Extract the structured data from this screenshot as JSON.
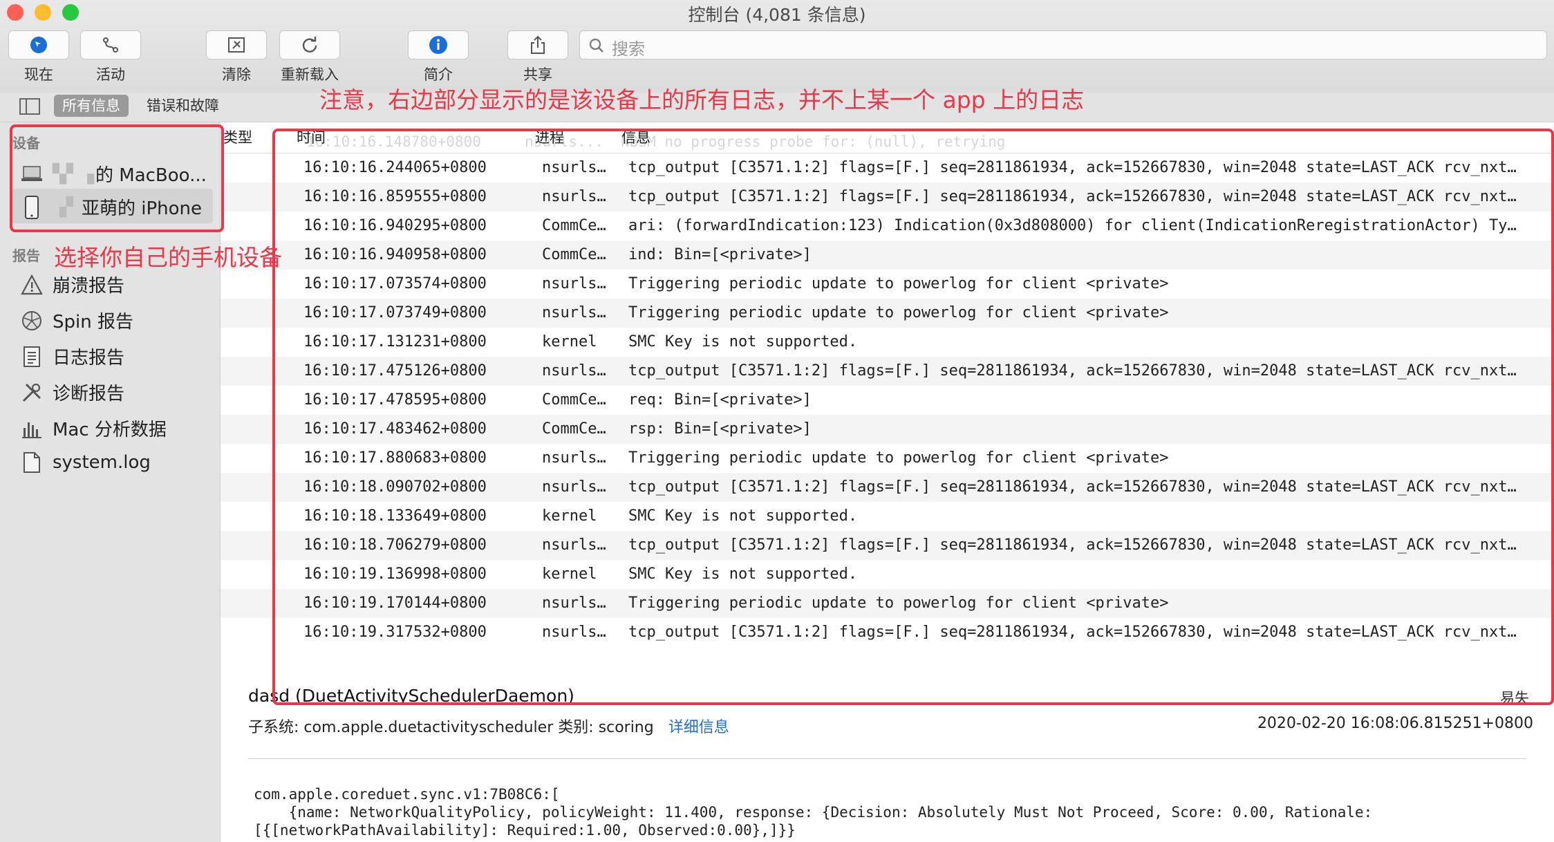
{
  "window": {
    "title": "控制台 (4,081 条信息)"
  },
  "toolbar": {
    "now": "现在",
    "activity": "活动",
    "clear": "清除",
    "reload": "重新载入",
    "info": "简介",
    "share": "共享",
    "search_placeholder": "搜索"
  },
  "filter": {
    "all": "所有信息",
    "errors": "错误和故障"
  },
  "sidebar": {
    "devices_header": "设备",
    "devices": [
      {
        "label": "的 MacBoo...",
        "icon": "laptop-icon"
      },
      {
        "label": "亚萌的 iPhone",
        "icon": "phone-icon"
      }
    ],
    "reports_header": "报告",
    "reports": [
      {
        "label": "崩溃报告",
        "icon": "warning-icon"
      },
      {
        "label": "Spin 报告",
        "icon": "spin-icon"
      },
      {
        "label": "日志报告",
        "icon": "document-icon"
      },
      {
        "label": "诊断报告",
        "icon": "tools-icon"
      },
      {
        "label": "Mac 分析数据",
        "icon": "bars-icon"
      },
      {
        "label": "system.log",
        "icon": "file-icon"
      }
    ]
  },
  "columns": {
    "type": "类型",
    "time": "时间",
    "process": "进程",
    "message": "信息"
  },
  "ghost_row": "16:10:16.148780+0800     nsurls...  NBSM no progress probe for: (null), retrying",
  "rows": [
    {
      "time": "16:10:16.244065+0800",
      "process": "nsurls…",
      "message": "tcp_output [C3571.1:2] flags=[F.] seq=2811861934, ack=152667830, win=2048 state=LAST_ACK rcv_nxt…"
    },
    {
      "time": "16:10:16.859555+0800",
      "process": "nsurls…",
      "message": "tcp_output [C3571.1:2] flags=[F.] seq=2811861934, ack=152667830, win=2048 state=LAST_ACK rcv_nxt…"
    },
    {
      "time": "16:10:16.940295+0800",
      "process": "CommCe…",
      "message": "ari: (forwardIndication:123) Indication(0x3d808000) for client(IndicationReregistrationActor) Ty…"
    },
    {
      "time": "16:10:16.940958+0800",
      "process": "CommCe…",
      "message": "ind: Bin=[<private>]"
    },
    {
      "time": "16:10:17.073574+0800",
      "process": "nsurls…",
      "message": "Triggering periodic update to powerlog for client <private>"
    },
    {
      "time": "16:10:17.073749+0800",
      "process": "nsurls…",
      "message": "Triggering periodic update to powerlog for client <private>"
    },
    {
      "time": "16:10:17.131231+0800",
      "process": "kernel",
      "message": "SMC Key      is not supported."
    },
    {
      "time": "16:10:17.475126+0800",
      "process": "nsurls…",
      "message": "tcp_output [C3571.1:2] flags=[F.] seq=2811861934, ack=152667830, win=2048 state=LAST_ACK rcv_nxt…"
    },
    {
      "time": "16:10:17.478595+0800",
      "process": "CommCe…",
      "message": "req: Bin=[<private>]"
    },
    {
      "time": "16:10:17.483462+0800",
      "process": "CommCe…",
      "message": "rsp: Bin=[<private>]"
    },
    {
      "time": "16:10:17.880683+0800",
      "process": "nsurls…",
      "message": "Triggering periodic update to powerlog for client <private>"
    },
    {
      "time": "16:10:18.090702+0800",
      "process": "nsurls…",
      "message": "tcp_output [C3571.1:2] flags=[F.] seq=2811861934, ack=152667830, win=2048 state=LAST_ACK rcv_nxt…"
    },
    {
      "time": "16:10:18.133649+0800",
      "process": "kernel",
      "message": "SMC Key      is not supported."
    },
    {
      "time": "16:10:18.706279+0800",
      "process": "nsurls…",
      "message": "tcp_output [C3571.1:2] flags=[F.] seq=2811861934, ack=152667830, win=2048 state=LAST_ACK rcv_nxt…"
    },
    {
      "time": "16:10:19.136998+0800",
      "process": "kernel",
      "message": "SMC Key      is not supported."
    },
    {
      "time": "16:10:19.170144+0800",
      "process": "nsurls…",
      "message": "Triggering periodic update to powerlog for client <private>"
    },
    {
      "time": "16:10:19.317532+0800",
      "process": "nsurls…",
      "message": "tcp_output [C3571.1:2] flags=[F.] seq=2811861934, ack=152667830, win=2048 state=LAST_ACK rcv_nxt…"
    }
  ],
  "detail": {
    "title": "dasd (DuetActivitySchedulerDaemon)",
    "status": "易失",
    "meta": "子系统:  com.apple.duetactivityscheduler  类别:  scoring",
    "link": "详细信息",
    "timestamp": "2020-02-20 16:08:06.815251+0800",
    "message_lines": [
      "com.apple.coreduet.sync.v1:7B08C6:[",
      "    {name: NetworkQualityPolicy, policyWeight: 11.400, response: {Decision: Absolutely Must Not Proceed, Score: 0.00, Rationale:",
      "[{[networkPathAvailability]: Required:1.00, Observed:0.00},]}}"
    ]
  },
  "annotations": {
    "top": "注意，右边部分显示的是该设备上的所有日志，并不上某一个 app 上的日志",
    "left": "选择你自己的手机设备"
  },
  "colors": {
    "annotation": "#e8384a",
    "accent": "#1a6fd6",
    "selected_pill": "#9a9a9a"
  }
}
